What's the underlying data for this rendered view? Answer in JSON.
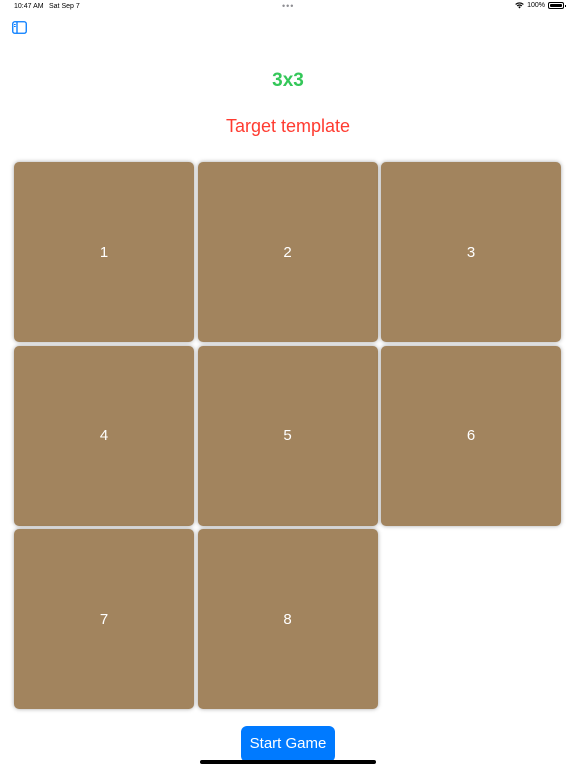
{
  "status_bar": {
    "time": "10:47 AM",
    "date": "Sat Sep 7",
    "dots": "•••",
    "battery": "100%",
    "wifi_icon": "wifi-icon",
    "battery_icon": "battery-icon"
  },
  "toolbar": {
    "sidebar_icon": "sidebar-toggle-icon"
  },
  "header": {
    "title": "3x3",
    "subtitle": "Target template"
  },
  "puzzle": {
    "tiles": [
      "1",
      "2",
      "3",
      "4",
      "5",
      "6",
      "7",
      "8",
      ""
    ]
  },
  "actions": {
    "start_label": "Start Game"
  },
  "colors": {
    "title": "#34c759",
    "subtitle": "#ff3b30",
    "tile": "#a2845e",
    "button": "#007aff"
  }
}
